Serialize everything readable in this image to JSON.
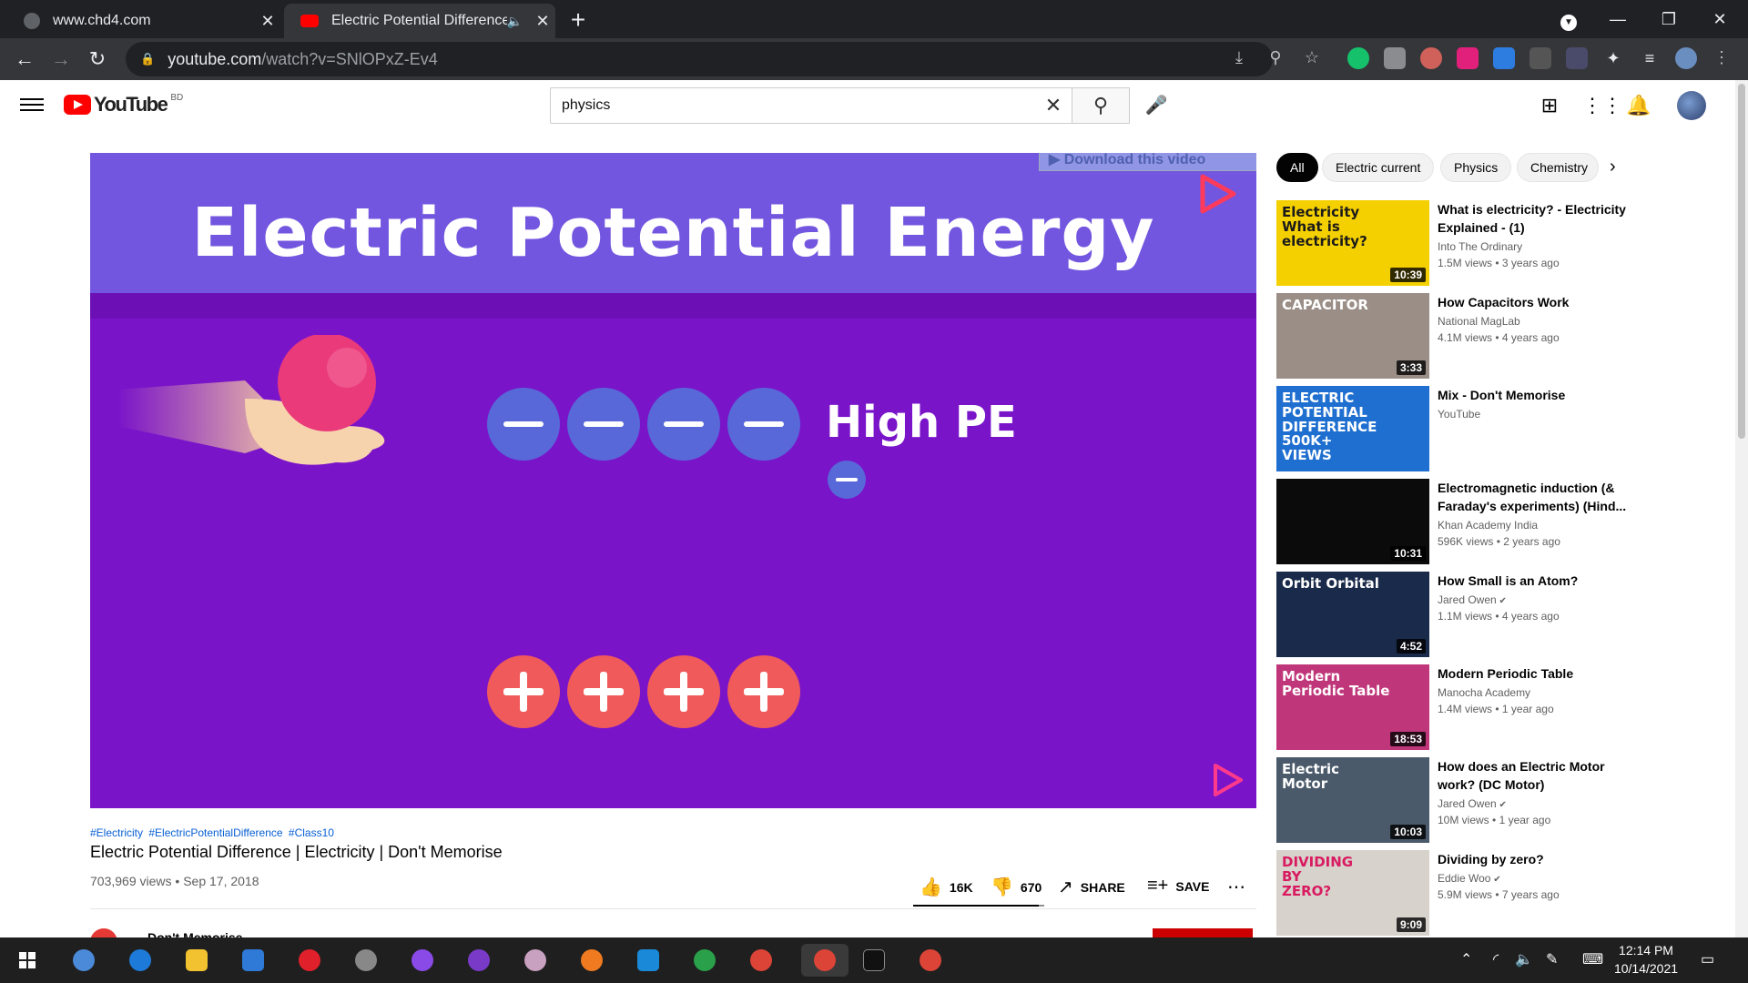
{
  "browser": {
    "tabs": [
      {
        "title": "www.chd4.com",
        "active": false
      },
      {
        "title": "Electric Potential Difference |",
        "active": true
      }
    ],
    "url_host": "youtube.com",
    "url_path": "/watch?v=SNlOPxZ-Ev4"
  },
  "youtube": {
    "logo_text": "YouTube",
    "country_code": "BD",
    "search_value": "physics"
  },
  "video": {
    "slide_title": "Electric Potential Energy",
    "slide_label": "High PE",
    "download_label": "▶ Download this video",
    "tags": [
      "#Electricity",
      "#ElectricPotentialDifference",
      "#Class10"
    ],
    "title": "Electric Potential Difference | Electricity | Don't Memorise",
    "views": "703,969 views",
    "date": "Sep 17, 2018",
    "likes": "16K",
    "dislikes": "670",
    "share_label": "SHARE",
    "save_label": "SAVE",
    "like_ratio": 0.96,
    "channel": "Don't Memorise"
  },
  "chips": [
    "All",
    "Electric current",
    "Physics",
    "Chemistry"
  ],
  "recommendations": [
    {
      "title": "What is electricity? - Electricity Explained - (1)",
      "channel": "Into The Ordinary",
      "verified": false,
      "views": "1.5M views",
      "age": "3 years ago",
      "duration": "10:39",
      "thumb_text": "Electricity\nWhat is electricity?",
      "thumb_color": "#f5d000"
    },
    {
      "title": "How Capacitors Work",
      "channel": "National MagLab",
      "verified": false,
      "views": "4.1M views",
      "age": "4 years ago",
      "duration": "3:33",
      "thumb_text": "CAPACITOR",
      "thumb_color": "#9a8e86"
    },
    {
      "title": "Mix - Don't Memorise",
      "channel": "YouTube",
      "verified": false,
      "views": "",
      "age": "",
      "duration": "",
      "thumb_text": "ELECTRIC\nPOTENTIAL DIFFERENCE\n500K+\nVIEWS",
      "thumb_color": "#1f6fd0"
    },
    {
      "title": "Electromagnetic induction (& Faraday's experiments) (Hind...",
      "channel": "Khan Academy India",
      "verified": false,
      "views": "596K views",
      "age": "2 years ago",
      "duration": "10:31",
      "thumb_text": "",
      "thumb_color": "#0b0b0b"
    },
    {
      "title": "How Small is an Atom?",
      "channel": "Jared Owen",
      "verified": true,
      "views": "1.1M views",
      "age": "4 years ago",
      "duration": "4:52",
      "thumb_text": "Orbit  Orbital",
      "thumb_color": "#1a2a4a"
    },
    {
      "title": "Modern Periodic Table",
      "channel": "Manocha Academy",
      "verified": false,
      "views": "1.4M views",
      "age": "1 year ago",
      "duration": "18:53",
      "thumb_text": "Modern\nPeriodic Table",
      "thumb_color": "#c0367a"
    },
    {
      "title": "How does an Electric Motor work? (DC Motor)",
      "channel": "Jared Owen",
      "verified": true,
      "views": "10M views",
      "age": "1 year ago",
      "duration": "10:03",
      "thumb_text": "Electric\nMotor",
      "thumb_color": "#4a5a6a"
    },
    {
      "title": "Dividing by zero?",
      "channel": "Eddie Woo",
      "verified": true,
      "views": "5.9M views",
      "age": "7 years ago",
      "duration": "9:09",
      "thumb_text": "DIVIDING\nBY\nZERO?",
      "thumb_color": "#d8d2cc"
    }
  ],
  "taskbar": {
    "time": "12:14 PM",
    "date": "10/14/2021"
  }
}
